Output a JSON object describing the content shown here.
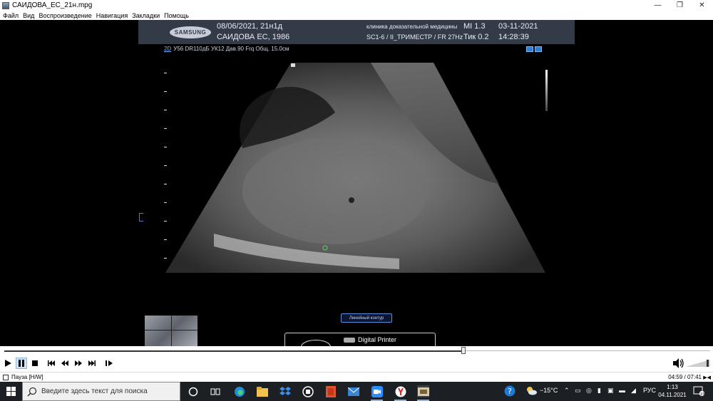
{
  "window": {
    "title": "САИДОВА_ЕС_21н.mpg",
    "minimize": "—",
    "maximize": "❐",
    "close": "✕"
  },
  "menu": [
    "Файл",
    "Вид",
    "Воспроизведение",
    "Навигация",
    "Закладки",
    "Помощь"
  ],
  "ultrasound": {
    "logo": "SAMSUNG",
    "date": "08/06/2021, 21н1д",
    "patient": "САИДОВА ЕС, 1986",
    "clinic": "клиника доказательной медицины",
    "probe": "SC1-6 / II_ТРИМЕСТР / FR 27Hz",
    "mi": "MI    1.3",
    "tik": "Тик  0.2",
    "date2": "03-11-2021",
    "time": "14:28:39",
    "mode": "2D",
    "params": "У56 DR110дБ УК12 Дав.90 Frq Общ. 15.0см",
    "contour_button": "Линейный контур",
    "printer": "Digital Printer"
  },
  "player": {
    "progress": 0.651,
    "status": "Пауза [H/W]",
    "time": "04:59 / 07:41"
  },
  "taskbar": {
    "search_placeholder": "Введите здесь текст для поиска",
    "weather": "−15°C",
    "lang": "РУС",
    "clock_time": "1:13",
    "clock_date": "04.11.2021",
    "notifications": "15"
  }
}
